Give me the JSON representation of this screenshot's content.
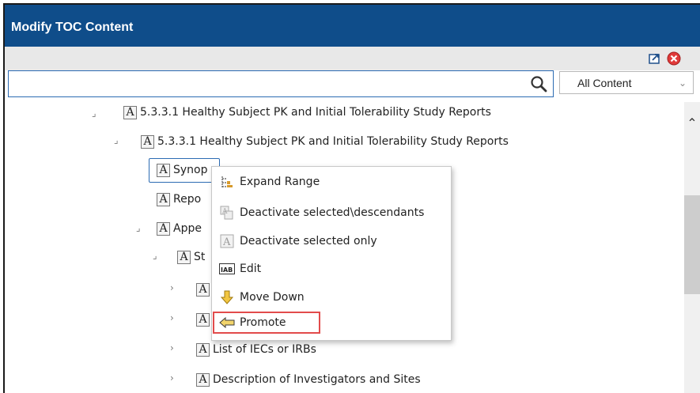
{
  "dialog": {
    "title": "Modify TOC Content"
  },
  "toolbar": {
    "icons": [
      "export-icon",
      "close-icon"
    ]
  },
  "search": {
    "value": "",
    "placeholder": ""
  },
  "filter": {
    "selected": "All Content"
  },
  "tree": {
    "rows": [
      {
        "label": "5.3.3.1 Healthy Subject PK and Initial Tolerability Study Reports",
        "twisty": "⌟"
      },
      {
        "label": "5.3.3.1 Healthy Subject PK and Initial Tolerability Study Reports",
        "twisty": "⌟"
      },
      {
        "label": "Synop",
        "twisty": ""
      },
      {
        "label": "Repo",
        "twisty": ""
      },
      {
        "label": "Appe",
        "twisty": "⌟"
      },
      {
        "label": "St",
        "twisty": "⌟"
      },
      {
        "label": "",
        "twisty": "›"
      },
      {
        "label": "",
        "twisty": "›"
      },
      {
        "label": "List of IECs or IRBs",
        "twisty": "›"
      },
      {
        "label": "Description of Investigators and Sites",
        "twisty": "›"
      }
    ]
  },
  "context_menu": {
    "items": [
      {
        "label": "Expand Range",
        "icon": "expand-range-icon"
      },
      {
        "label": "Deactivate selected\\descendants",
        "icon": "deactivate-descendants-icon"
      },
      {
        "label": "Deactivate selected only",
        "icon": "deactivate-only-icon"
      },
      {
        "label": "Edit",
        "icon": "edit-icon"
      },
      {
        "label": "Move Down",
        "icon": "move-down-icon"
      },
      {
        "label": "Promote",
        "icon": "promote-icon"
      }
    ]
  },
  "colors": {
    "titlebar": "#0f4d8a",
    "highlight": "#e24b4b",
    "selection": "#2c6bb3"
  }
}
